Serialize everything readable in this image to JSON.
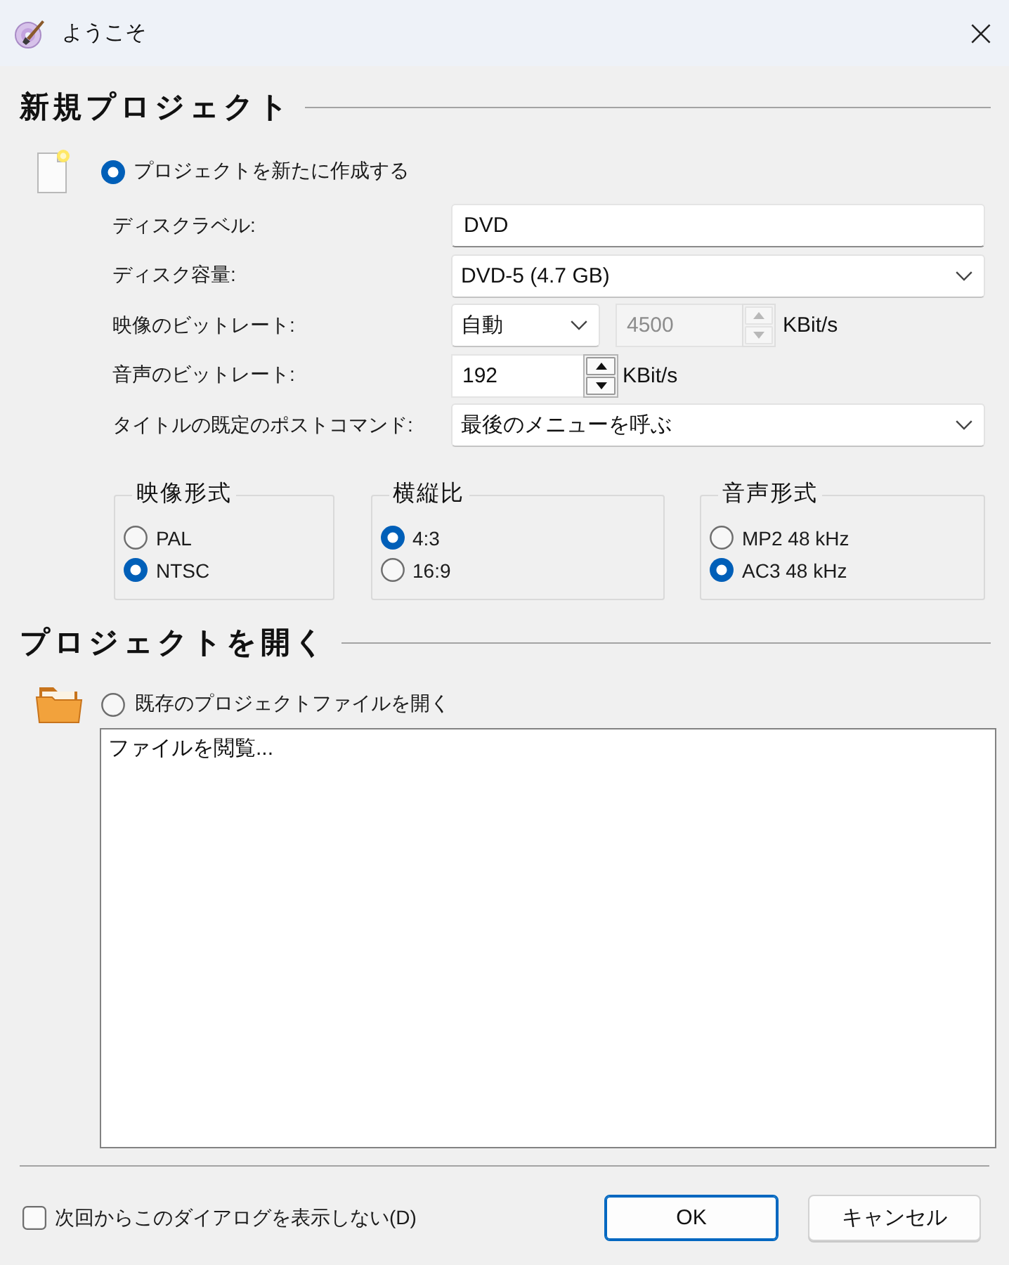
{
  "window": {
    "title": "ようこそ"
  },
  "new_project": {
    "heading": "新規プロジェクト",
    "option": {
      "label": "プロジェクトを新たに作成する",
      "selected": true
    },
    "fields": [
      {
        "kind": "text",
        "label": "ディスクラベル:",
        "value": "DVD"
      },
      {
        "kind": "select",
        "label": "ディスク容量:",
        "value": "DVD-5 (4.7 GB)"
      },
      {
        "kind": "select_spin",
        "label": "映像のビットレート:",
        "value": "自動",
        "spin": {
          "value": "4500",
          "disabled": true
        },
        "unit": "KBit/s"
      },
      {
        "kind": "spin",
        "label": "音声のビットレート:",
        "value": "192",
        "disabled": false,
        "unit": "KBit/s"
      },
      {
        "kind": "select",
        "label": "タイトルの既定のポストコマンド:",
        "value": "最後のメニューを呼ぶ"
      }
    ],
    "groups": [
      {
        "title": "映像形式",
        "options": [
          {
            "label": "PAL",
            "selected": false
          },
          {
            "label": "NTSC",
            "selected": true
          }
        ]
      },
      {
        "title": "横縦比",
        "options": [
          {
            "label": "4:3",
            "selected": true
          },
          {
            "label": "16:9",
            "selected": false
          }
        ]
      },
      {
        "title": "音声形式",
        "options": [
          {
            "label": "MP2 48 kHz",
            "selected": false
          },
          {
            "label": "AC3 48 kHz",
            "selected": true
          }
        ]
      }
    ]
  },
  "open_project": {
    "heading": "プロジェクトを開く",
    "option": {
      "label": "既存のプロジェクトファイルを開く",
      "selected": false
    },
    "file_list": {
      "items": [
        "ファイルを閲覧..."
      ]
    }
  },
  "footer": {
    "checkbox": {
      "label": "次回からこのダイアログを表示しない(D)",
      "checked": false
    },
    "buttons": [
      {
        "label": "OK",
        "default": true
      },
      {
        "label": "キャンセル",
        "default": false
      }
    ]
  }
}
